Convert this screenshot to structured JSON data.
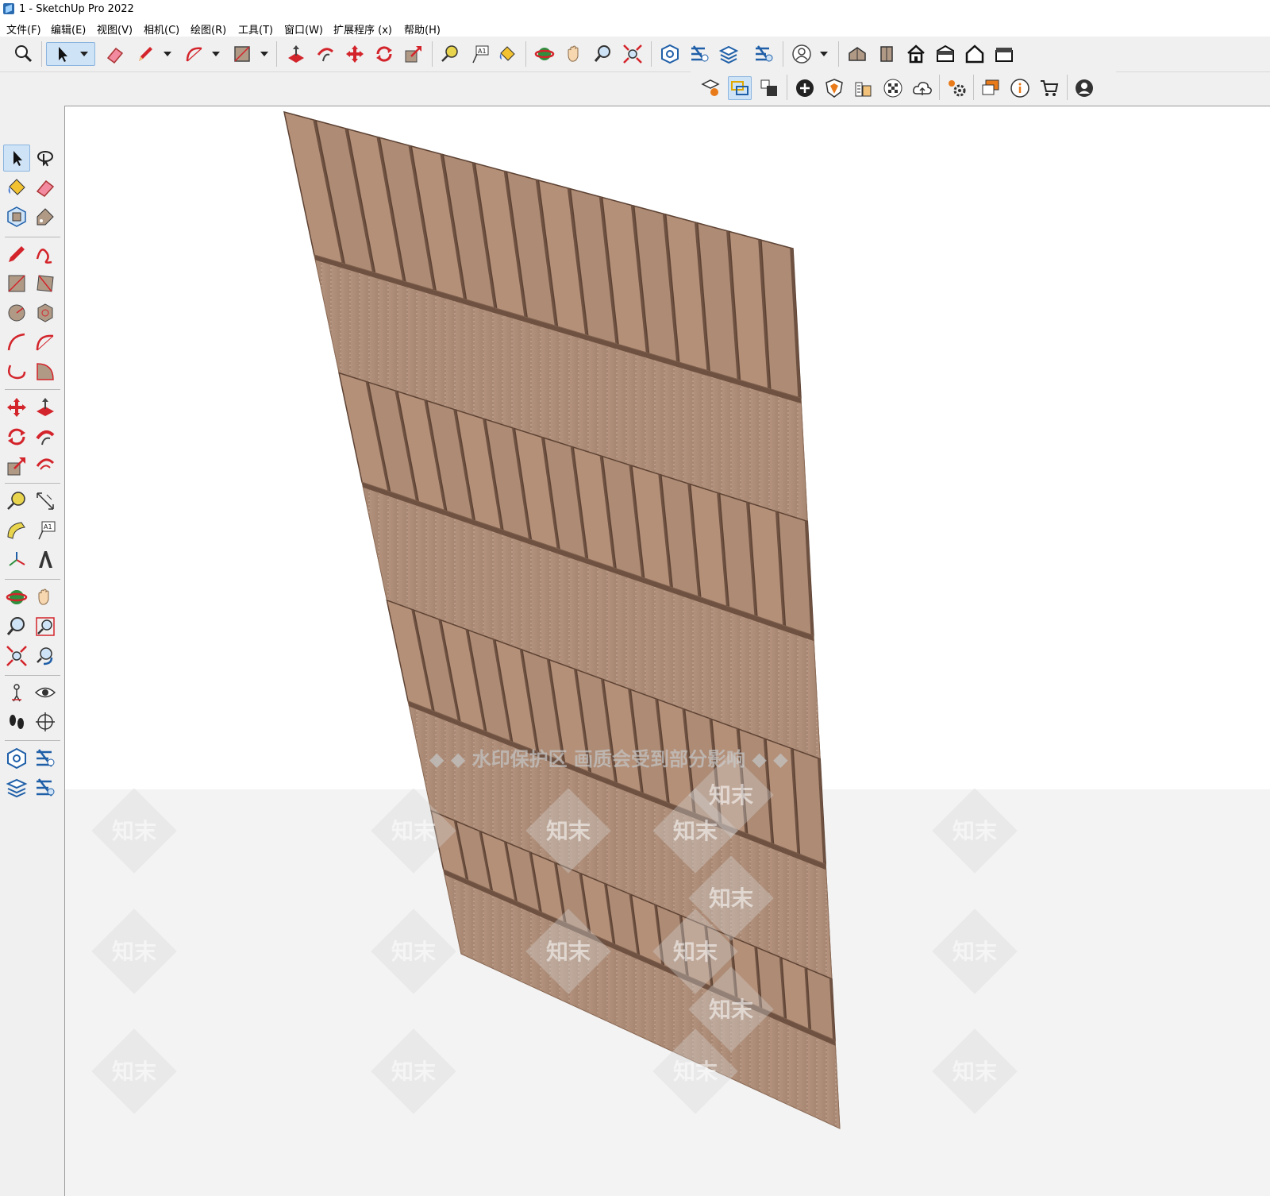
{
  "window": {
    "title": "1 - SketchUp Pro 2022"
  },
  "menu": [
    "文件(F)",
    "编辑(E)",
    "视图(V)",
    "相机(C)",
    "绘图(R)",
    "工具(T)",
    "窗口(W)",
    "扩展程序 (x)",
    "帮助(H)"
  ],
  "toolbar_icons": [
    "zoom-icon",
    "select-icon",
    "eraser-icon",
    "pencil-icon",
    "arc-icon",
    "rectangle-icon",
    "push-pull-icon",
    "follow-me-icon",
    "move-icon",
    "rotate-icon",
    "scale-icon",
    "tape-measure-icon",
    "text-icon",
    "paint-bucket-icon",
    "orbit-icon",
    "pan-icon",
    "zoom-tool-icon",
    "zoom-extents-icon",
    "warehouse-icon",
    "share-model-icon",
    "extension-warehouse-icon",
    "extension-manager-icon",
    "account-icon",
    "iso-view-icon",
    "front-view-icon",
    "top-view-icon",
    "right-view-icon",
    "back-view-icon",
    "left-view-icon"
  ],
  "toolbar2_icons": [
    "component-options-icon",
    "solid-union-icon",
    "solid-subtract-icon",
    "add-icon",
    "shield-icon",
    "building-icon",
    "checker-icon",
    "cloud-upload-icon",
    "settings-icon",
    "dialog-icon",
    "info-icon",
    "cart-icon",
    "user-icon"
  ],
  "watermark": {
    "banner": "◆ ◆ 水印保护区  画质会受到部分影响 ◆ ◆",
    "logo": "知末"
  },
  "colors": {
    "wood_light": "#b4927a",
    "wood_mid": "#a88670",
    "wood_dark": "#6e5141",
    "highlight": "#cfe3f7",
    "accent_red": "#d3242b"
  }
}
